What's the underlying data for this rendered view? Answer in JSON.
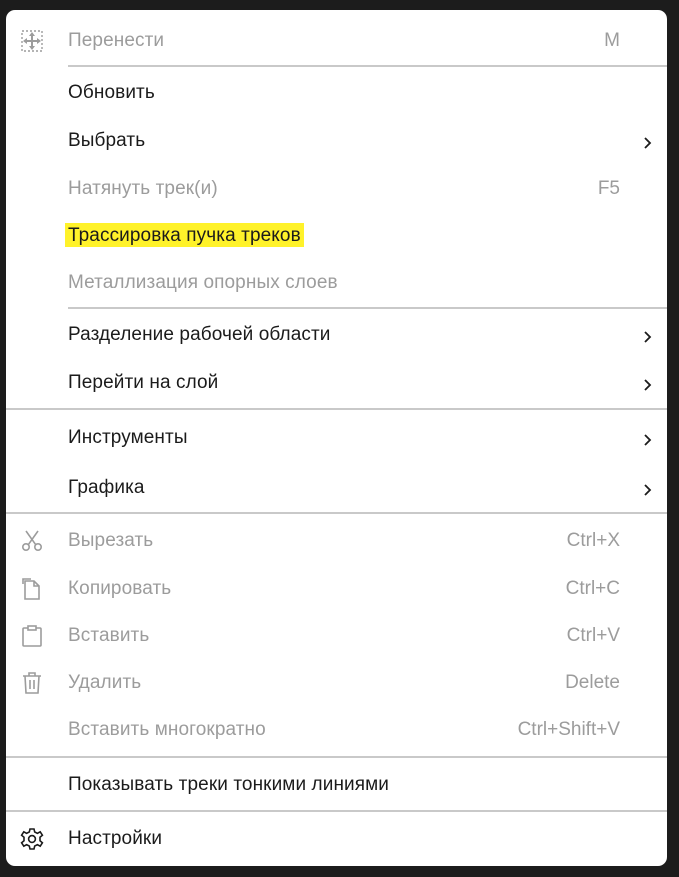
{
  "menu": {
    "move": {
      "label": "Перенести",
      "shortcut": "M",
      "icon": "move-selection-icon"
    },
    "refresh": {
      "label": "Обновить"
    },
    "select": {
      "label": "Выбрать"
    },
    "stretch_tracks": {
      "label": "Натянуть трек(и)",
      "shortcut": "F5"
    },
    "bundle_routing": {
      "label": "Трассировка пучка треков",
      "highlight_color": "#fff22a"
    },
    "metallization": {
      "label": "Металлизация опорных слоев"
    },
    "split_workspace": {
      "label": "Разделение рабочей области"
    },
    "go_to_layer": {
      "label": "Перейти на слой"
    },
    "tools": {
      "label": "Инструменты"
    },
    "graphics": {
      "label": "Графика"
    },
    "cut": {
      "label": "Вырезать",
      "shortcut": "Ctrl+X",
      "icon": "scissors-icon"
    },
    "copy": {
      "label": "Копировать",
      "shortcut": "Ctrl+C",
      "icon": "copy-icon"
    },
    "paste": {
      "label": "Вставить",
      "shortcut": "Ctrl+V",
      "icon": "clipboard-icon"
    },
    "delete": {
      "label": "Удалить",
      "shortcut": "Delete",
      "icon": "trash-icon"
    },
    "paste_multiple": {
      "label": "Вставить многократно",
      "shortcut": "Ctrl+Shift+V"
    },
    "thin_lines": {
      "label": "Показывать треки тонкими линиями"
    },
    "settings": {
      "label": "Настройки",
      "icon": "gear-icon"
    }
  },
  "colors": {
    "enabled_text": "#1b1b1b",
    "disabled_text": "#9c9c9c",
    "separator": "#c9c9c9",
    "highlight": "#fff22a"
  }
}
